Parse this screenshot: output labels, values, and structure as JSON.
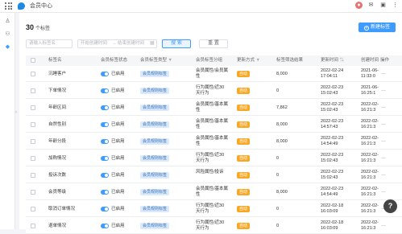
{
  "header": {
    "app_title": "会员中心",
    "icons": [
      "grid-icon",
      "logo-icon",
      "avatar-icon",
      "mail-icon",
      "tag-icon",
      "more-icon"
    ]
  },
  "sidebar": {
    "icons": [
      "member-icon",
      "group-icon",
      "tag-icon"
    ]
  },
  "summary": {
    "count": "30",
    "unit": "个标签"
  },
  "toolbar": {
    "new_label": "新建标签",
    "search_placeholder": "请输入标签名",
    "date_start_placeholder": "开始创建时间",
    "date_separator": "→",
    "date_end_placeholder": "结束创建时间",
    "search_button": "搜 索",
    "reset_button": "重 置"
  },
  "table": {
    "columns": [
      "标签名",
      "会员标签状态",
      "会员标签类型",
      "会员标签分组",
      "更新方式",
      "标签筛选结果",
      "更新时间",
      "创建时间",
      "操作"
    ],
    "rows": [
      {
        "name": "沉睡客户",
        "status": "已启用",
        "type": "会员规则标签",
        "group": [
          "会员属性/会员属",
          "性"
        ],
        "update": "自动",
        "result": "8,000",
        "updated": [
          "2022-02-24",
          "17:04:11"
        ],
        "created": [
          "2021-06-",
          "11:33:0"
        ],
        "op": "…"
      },
      {
        "name": "下单情况",
        "status": "已启用",
        "type": "会员规则标签",
        "group": [
          "行为属性/近30",
          "天行为"
        ],
        "update": "自动",
        "result": "0",
        "updated": [
          "2022-02-23",
          "15:02:43"
        ],
        "created": [
          "2021-06-",
          "16:25:1"
        ],
        "op": "…"
      },
      {
        "name": "年龄区间",
        "status": "已启用",
        "type": "会员规则标签",
        "group": [
          "会员属性/基本属",
          "性"
        ],
        "update": "自动",
        "result": "7,862",
        "updated": [
          "2022-02-23",
          "15:02:43"
        ],
        "created": [
          "2022-02-",
          "16:21:3"
        ],
        "op": "…"
      },
      {
        "name": "自然性别",
        "status": "已启用",
        "type": "会员规则标签",
        "group": [
          "会员属性/基本属",
          "性"
        ],
        "update": "自动",
        "result": "8,000",
        "updated": [
          "2022-02-23",
          "14:57:43"
        ],
        "created": [
          "2022-02-",
          "16:21:3"
        ],
        "op": "…"
      },
      {
        "name": "年龄分段",
        "status": "已启用",
        "type": "会员规则标签",
        "group": [
          "会员属性/基本属",
          "性"
        ],
        "update": "自动",
        "result": "8,000",
        "updated": [
          "2022-02-23",
          "14:54:49"
        ],
        "created": [
          "2022-02-",
          "16:21:3"
        ],
        "op": "…"
      },
      {
        "name": "加购情况",
        "status": "已启用",
        "type": "会员规则标签",
        "group": [
          "行为属性/近30",
          "天行为"
        ],
        "update": "自动",
        "result": "0",
        "updated": [
          "2022-02-23",
          "15:02:43"
        ],
        "created": [
          "2022-02-",
          "16:21:3"
        ],
        "op": "…"
      },
      {
        "name": "投诉次数",
        "status": "已启用",
        "type": "会员规则标签",
        "group": [
          "风险属性/投诉"
        ],
        "update": "自动",
        "result": "0",
        "updated": [
          "2022-02-23",
          "15:02:43"
        ],
        "created": [
          "2022-02-",
          "16:21:3"
        ],
        "op": "…"
      },
      {
        "name": "会员等级",
        "status": "已启用",
        "type": "会员规则标签",
        "group": [
          "会员属性/基本属",
          "性"
        ],
        "update": "自动",
        "result": "8,000",
        "updated": [
          "2022-02-23",
          "14:54:49"
        ],
        "created": [
          "2022-02-",
          "16:21:3"
        ],
        "op": "…"
      },
      {
        "name": "取消订单情况",
        "status": "已启用",
        "type": "会员规则标签",
        "group": [
          "行为属性/近30",
          "天行为"
        ],
        "update": "自动",
        "result": "0",
        "updated": [
          "2022-02-18",
          "16:03:09"
        ],
        "created": [
          "2022-02-",
          "16:21:3"
        ],
        "op": "…"
      },
      {
        "name": "退单情况",
        "status": "已启用",
        "type": "会员规则标签",
        "group": [
          "行为属性/近30",
          "天行为"
        ],
        "update": "自动",
        "result": "0",
        "updated": [
          "2022-02-18",
          "16:03:09"
        ],
        "created": [
          "2022-02-",
          "16:21:3"
        ],
        "op": "…"
      }
    ]
  },
  "help": {
    "label": "?"
  },
  "colors": {
    "accent": "#3e9bff",
    "tag_blue_bg": "#dbe9fb",
    "auto_tag": "#f9a825"
  }
}
